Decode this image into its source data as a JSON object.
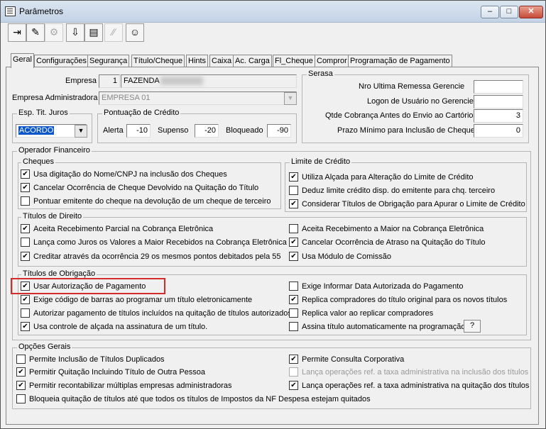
{
  "window": {
    "title": "Parâmetros"
  },
  "toolbar": {
    "buttons": [
      {
        "name": "exit",
        "icon": "⇥"
      },
      {
        "name": "edit",
        "icon": "✎"
      },
      {
        "name": "tools",
        "icon": "⚙"
      },
      {
        "name": "download",
        "icon": "⇩"
      },
      {
        "name": "print",
        "icon": "▤"
      },
      {
        "name": "disabled",
        "icon": "∕∕"
      },
      {
        "name": "user",
        "icon": "☺"
      }
    ]
  },
  "tabs": [
    "Geral",
    "Configurações",
    "Segurança",
    "Título/Cheque",
    "Hints",
    "Caixa",
    "Ac. Carga",
    "Fl_Cheque",
    "Compror",
    "Programação de Pagamento"
  ],
  "empresa": {
    "label": "Empresa",
    "code": "1",
    "name": "FAZENDA"
  },
  "empresa_adm": {
    "label": "Empresa Administradora",
    "value": "EMPRESA 01"
  },
  "esp_tit_juros": {
    "title": "Esp. Tit. Juros",
    "value": "ACORDO"
  },
  "pontuacao": {
    "title": "Pontuação de Crédito",
    "alerta_label": "Alerta",
    "alerta": "-10",
    "supenso_label": "Supenso",
    "supenso": "-20",
    "bloqueado_label": "Bloqueado",
    "bloqueado": "-90"
  },
  "serasa": {
    "title": "Serasa",
    "rows": [
      {
        "label": "Nro Ultima Remessa Gerencie",
        "value": ""
      },
      {
        "label": "Logon de Usuário no Gerencie",
        "value": ""
      },
      {
        "label": "Qtde Cobrança  Antes do Envio ao Cartório",
        "value": "3"
      },
      {
        "label": "Prazo Mínimo para Inclusão de Cheque",
        "value": "0"
      }
    ]
  },
  "operador": {
    "title": "Operador Financeiro"
  },
  "cheques": {
    "title": "Cheques",
    "items": [
      {
        "label": "Usa digitação do Nome/CNPJ na inclusão dos Cheques",
        "checked": "✔"
      },
      {
        "label": "Cancelar Ocorrência de Cheque Devolvido na Quitação do Título",
        "checked": "✔"
      },
      {
        "label": "Pontuar emitente do cheque na devolução de um cheque de terceiro",
        "checked": ""
      }
    ]
  },
  "limite": {
    "title": "Limite de Crédito",
    "items": [
      {
        "label": "Utiliza Alçada para Alteração do Limite de Crédito",
        "checked": "✔"
      },
      {
        "label": "Deduz limite crédito disp. do emitente para chq. terceiro",
        "checked": ""
      },
      {
        "label": "Considerar Títulos de Obrigação para Apurar o Limite de Crédito",
        "checked": "✔"
      }
    ]
  },
  "titulos_direito": {
    "title": "Títulos de Direito",
    "left": [
      {
        "label": "Aceita Recebimento Parcial na Cobrança Eletrônica",
        "checked": "✔"
      },
      {
        "label": "Lança como Juros os Valores a Maior Recebidos na Cobrança Eletrônica",
        "checked": ""
      },
      {
        "label": "Creditar através da ocorrência 29 os mesmos pontos debitados pela 55",
        "checked": "✔"
      }
    ],
    "right": [
      {
        "label": "Aceita Recebimento a Maior na Cobrança Eletrônica",
        "checked": ""
      },
      {
        "label": "Cancelar Ocorrência de Atraso na Quitação do Título",
        "checked": "✔"
      },
      {
        "label": "Usa Módulo de Comissão",
        "checked": "✔"
      }
    ]
  },
  "titulos_obrigacao": {
    "title": "Títulos de Obrigação",
    "left": [
      {
        "label": "Usar Autorização de Pagamento",
        "checked": "✔"
      },
      {
        "label": "Exige código de barras ao programar um título eletronicamente",
        "checked": "✔"
      },
      {
        "label": "Autorizar pagamento de títulos incluídos na quitação de títulos autorizados",
        "checked": ""
      },
      {
        "label": "Usa controle de alçada na assinatura de um título.",
        "checked": "✔"
      }
    ],
    "right": [
      {
        "label": "Exige Informar Data Autorizada do Pagamento",
        "checked": ""
      },
      {
        "label": "Replica compradores do título original para os novos títulos",
        "checked": "✔"
      },
      {
        "label": "Replica valor ao replicar compradores",
        "checked": ""
      },
      {
        "label": "Assina título automaticamente na programação.",
        "checked": ""
      }
    ],
    "help_button": "?"
  },
  "opcoes_gerais": {
    "title": "Opções Gerais",
    "left": [
      {
        "label": "Permite Inclusão de Títulos Duplicados",
        "checked": ""
      },
      {
        "label": "Permitir Quitação Incluindo Título de Outra Pessoa",
        "checked": "✔"
      },
      {
        "label": "Permitir recontabilizar múltiplas empresas administradoras",
        "checked": "✔"
      },
      {
        "label": "Bloqueia quitação de títulos até que todos os títulos de Impostos da NF Despesa estejam quitados",
        "checked": ""
      }
    ],
    "right": [
      {
        "label": "Permite Consulta Corporativa",
        "checked": "✔"
      },
      {
        "label": "Lança operações ref. a taxa administrativa na inclusão dos títulos",
        "checked": ""
      },
      {
        "label": "Lança operações ref. a taxa administrativa na quitação dos títulos",
        "checked": "✔"
      }
    ]
  }
}
